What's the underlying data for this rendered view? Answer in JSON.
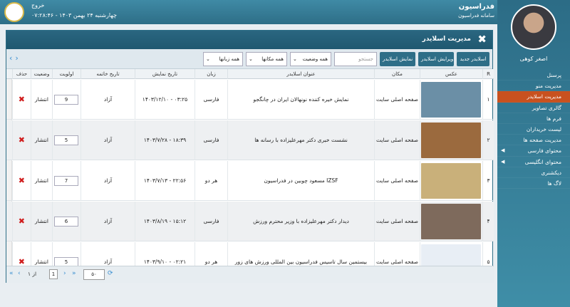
{
  "header": {
    "title": "فدراسیون",
    "subtitle": "سامانه فدراسیون",
    "logout": "خروج",
    "datetime": "چهارشنبه ۲۴ بهمن ۱۴۰۳ - ۰۷:۲۸:۴۶"
  },
  "user": {
    "name": "اصغر کوهی"
  },
  "menu": [
    {
      "label": "پرسنل",
      "active": false
    },
    {
      "label": "مدیریت منو",
      "active": false
    },
    {
      "label": "مدیریت اسلایدر",
      "active": true
    },
    {
      "label": "گالری تصاویر",
      "active": false
    },
    {
      "label": "فرم ها",
      "active": false
    },
    {
      "label": "لیست خریداران",
      "active": false
    },
    {
      "label": "مدیریت صفحه ها",
      "active": false
    },
    {
      "label": "محتوای فارسی",
      "active": false,
      "expandable": true
    },
    {
      "label": "محتوای انگلیسی",
      "active": false,
      "expandable": true
    },
    {
      "label": "دیکشنری",
      "active": false
    },
    {
      "label": "لاگ ها",
      "active": false
    }
  ],
  "panel": {
    "title": "مدیریت اسلایدر",
    "close_icon": "close-icon"
  },
  "toolbar": {
    "new": "اسلایدر جدید",
    "edit": "ویرایش اسلایدر",
    "view": "نمایش اسلایدر",
    "search_placeholder": "جستجو",
    "status_filter": "همه وضعیت",
    "place_filter": "همه مکانها",
    "lang_filter": "همه زبانها"
  },
  "table": {
    "columns": {
      "r": "R",
      "image": "عکس",
      "place": "مکان",
      "title": "عنوان اسلایدر",
      "lang": "زبان",
      "show_date": "تاریخ نمایش",
      "end_date": "تاریخ خاتمه",
      "priority": "اولویت",
      "status": "وضعیت",
      "delete": "حذف"
    },
    "rows": [
      {
        "r": "۱",
        "place": "صفحه اصلی سایت",
        "title": "نمایش خیره کننده نونهالان ایران در چانگجو",
        "lang": "فارسی",
        "show_date": "۱۴۰۳/۱۲/۱۰ - ۰۳:۲۵",
        "end_date": "آزاد",
        "priority": "9",
        "status": "انتشار",
        "thumb_color": "#6b8fa6"
      },
      {
        "r": "۲",
        "place": "صفحه اصلی سایت",
        "title": "نشست خبری دکتر مهرعلیزاده با رسانه ها",
        "lang": "فارسی",
        "show_date": "۱۴۰۳/۷/۲۸ - ۱۸:۳۹",
        "end_date": "آزاد",
        "priority": "5",
        "status": "انتشار",
        "thumb_color": "#9b6a3e"
      },
      {
        "r": "۳",
        "place": "صفحه اصلی سایت",
        "title": "مسعود چوبین در فدراسیون IZSF",
        "lang": "هر دو",
        "show_date": "۱۴۰۳/۷/۱۳ - ۲۲:۵۶",
        "end_date": "آزاد",
        "priority": "7",
        "status": "انتشار",
        "thumb_color": "#c9b07a"
      },
      {
        "r": "۴",
        "place": "صفحه اصلی سایت",
        "title": "دیدار دکتر مهرعلیزاده با وزیر محترم ورزش",
        "lang": "فارسی",
        "show_date": "۱۴۰۳/۸/۱۹ - ۱۵:۱۲",
        "end_date": "آزاد",
        "priority": "6",
        "status": "انتشار",
        "thumb_color": "#7e6a5c"
      },
      {
        "r": "۵",
        "place": "صفحه اصلی سایت",
        "title": "بیستمین سال تاسیس فدراسیون بین المللی ورزش های زور",
        "lang": "هر دو",
        "show_date": "۱۴۰۳/۹/۱۰ - ۰۲:۲۱",
        "end_date": "آزاد",
        "priority": "5",
        "status": "انتشار",
        "thumb_color": "#e8eef5"
      }
    ]
  },
  "pager": {
    "page": "1",
    "of_text": "از ۱",
    "page_size": "۵۰",
    "refresh_icon": "refresh-icon"
  }
}
